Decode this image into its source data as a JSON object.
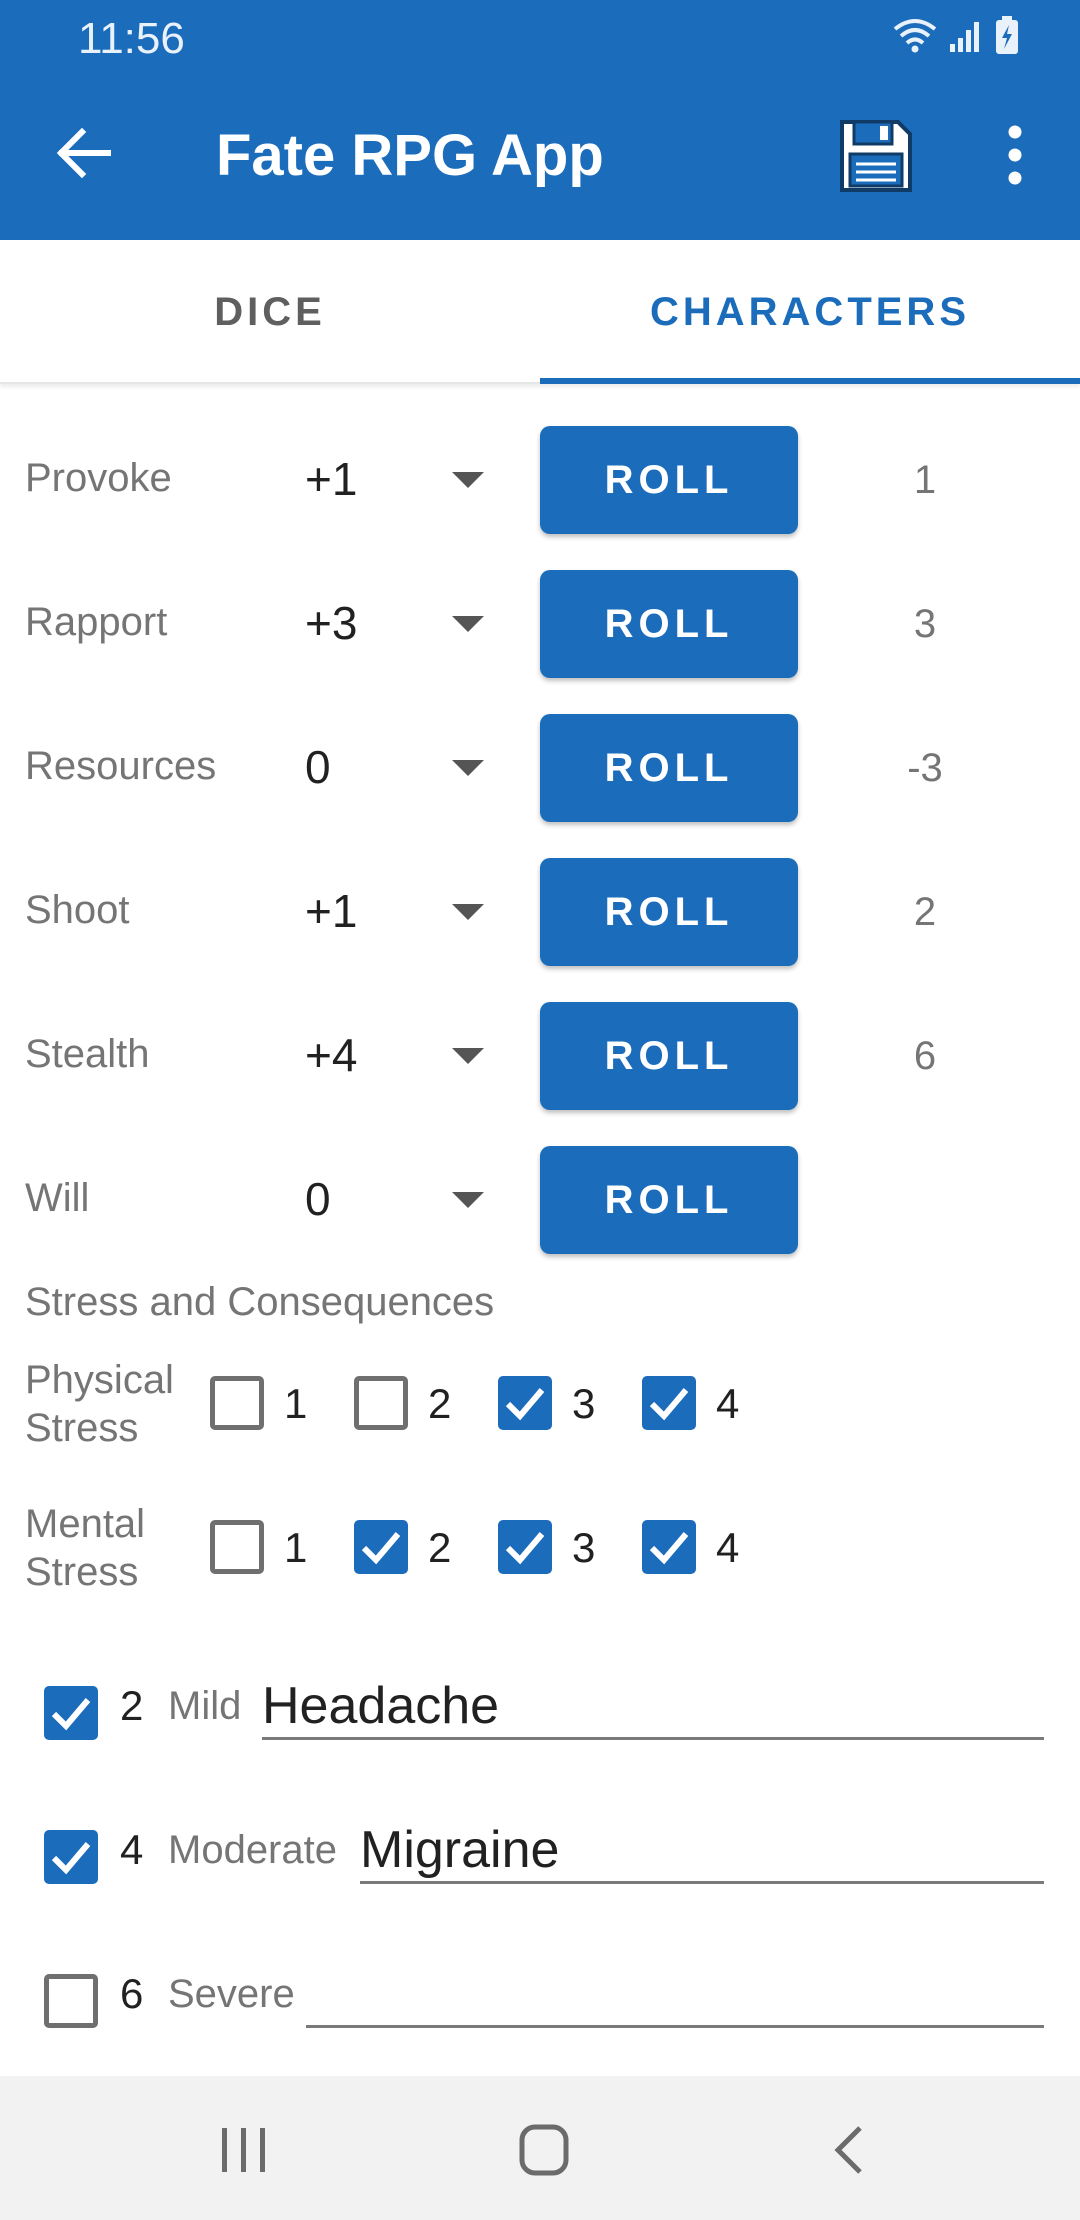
{
  "status_bar": {
    "time": "11:56"
  },
  "app_bar": {
    "title": "Fate RPG App"
  },
  "tabs": [
    {
      "label": "DICE",
      "selected": false
    },
    {
      "label": "CHARACTERS",
      "selected": true
    }
  ],
  "skills": [
    {
      "name": "Provoke",
      "value": "+1",
      "roll_label": "ROLL",
      "result": "1"
    },
    {
      "name": "Rapport",
      "value": "+3",
      "roll_label": "ROLL",
      "result": "3"
    },
    {
      "name": "Resources",
      "value": "0",
      "roll_label": "ROLL",
      "result": "-3"
    },
    {
      "name": "Shoot",
      "value": "+1",
      "roll_label": "ROLL",
      "result": "2"
    },
    {
      "name": "Stealth",
      "value": "+4",
      "roll_label": "ROLL",
      "result": "6"
    },
    {
      "name": "Will",
      "value": "0",
      "roll_label": "ROLL",
      "result": ""
    }
  ],
  "stress": {
    "title": "Stress and Consequences",
    "physical": {
      "label_line1": "Physical",
      "label_line2": "Stress",
      "boxes": [
        {
          "num": "1",
          "checked": false
        },
        {
          "num": "2",
          "checked": false
        },
        {
          "num": "3",
          "checked": true
        },
        {
          "num": "4",
          "checked": true
        }
      ]
    },
    "mental": {
      "label_line1": "Mental",
      "label_line2": "Stress",
      "boxes": [
        {
          "num": "1",
          "checked": false
        },
        {
          "num": "2",
          "checked": true
        },
        {
          "num": "3",
          "checked": true
        },
        {
          "num": "4",
          "checked": true
        }
      ]
    }
  },
  "consequences": [
    {
      "shift": "2",
      "label": "Mild",
      "value": "Headache",
      "checked": true
    },
    {
      "shift": "4",
      "label": "Moderate",
      "value": "Migraine",
      "checked": true
    },
    {
      "shift": "6",
      "label": "Severe",
      "value": "",
      "checked": false
    }
  ],
  "colors": {
    "primary": "#1b6cbb",
    "secondary_text": "#757575",
    "nav_bar": "#f2f2f2"
  },
  "icons": [
    "wifi-icon",
    "signal-icon",
    "battery-icon",
    "back-arrow-icon",
    "save-icon",
    "more-vert-icon",
    "dropdown-arrow-icon",
    "check-icon",
    "recent-apps-icon",
    "home-icon",
    "nav-back-icon"
  ]
}
